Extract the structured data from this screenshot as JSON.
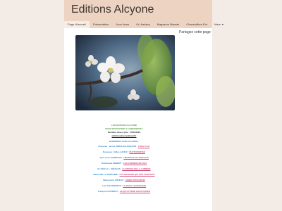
{
  "site": {
    "title": "Editions Alcyone"
  },
  "nav": {
    "items": [
      "Page d'accueil",
      "Présentation",
      "Jeux livres",
      "Où lire/acq",
      "Magazine Marsak",
      "Chaos/offers Ent",
      "Mars"
    ],
    "more_chevron": "▾"
  },
  "share": {
    "label": "Partagez cette page"
  },
  "info": {
    "line1": "LES EDITIONS ALCYONE",
    "line2": "VOUS SOUHAITENT LA BIENVENUE !",
    "line3": "Dernière mise à jour : 15/11/2024",
    "email": "editionsalcyone@neuf.fr",
    "pubs_heading": "DERNIÈRES PUBLICATIONS :"
  },
  "publications": [
    {
      "author": "Nouveau : Hervé PÉROUSE-GUESTIN",
      "book": "L'ŒUF LUO"
    },
    {
      "author": "Nouveau : Gilles LANUX",
      "book": "PHYTOPORTES"
    },
    {
      "author": "Jean-Louis BERNARD",
      "book": "HÉRITAGE DU PORTULE"
    },
    {
      "author": "Dominique HEBERT",
      "book": "LES CHEMINS DE PAIX"
    },
    {
      "author": "M. DIAZ et L. SIBALDA",
      "book": "AU ROUGE DE LA LUMIÈRE"
    },
    {
      "author": "Martia DE LA FONTAINE",
      "book": "LES MAISONS QUI ONT PORTRAIT"
    },
    {
      "author": "Marc-Henri ARFEUX",
      "book": "ANIMA PROSATION"
    },
    {
      "author": "Loïc CHASSERIOS",
      "book": "LE PASY LELIROCOZE"
    },
    {
      "author": "François COUDRAY",
      "book": "CE QU'ATTEND SOUS PAPIER"
    }
  ],
  "colors": {
    "banner": "#ecd3c2",
    "page_bg": "#f2ebe6",
    "green": "#4a9a3b",
    "blue": "#2d8bd1",
    "pink": "#d3487a"
  }
}
